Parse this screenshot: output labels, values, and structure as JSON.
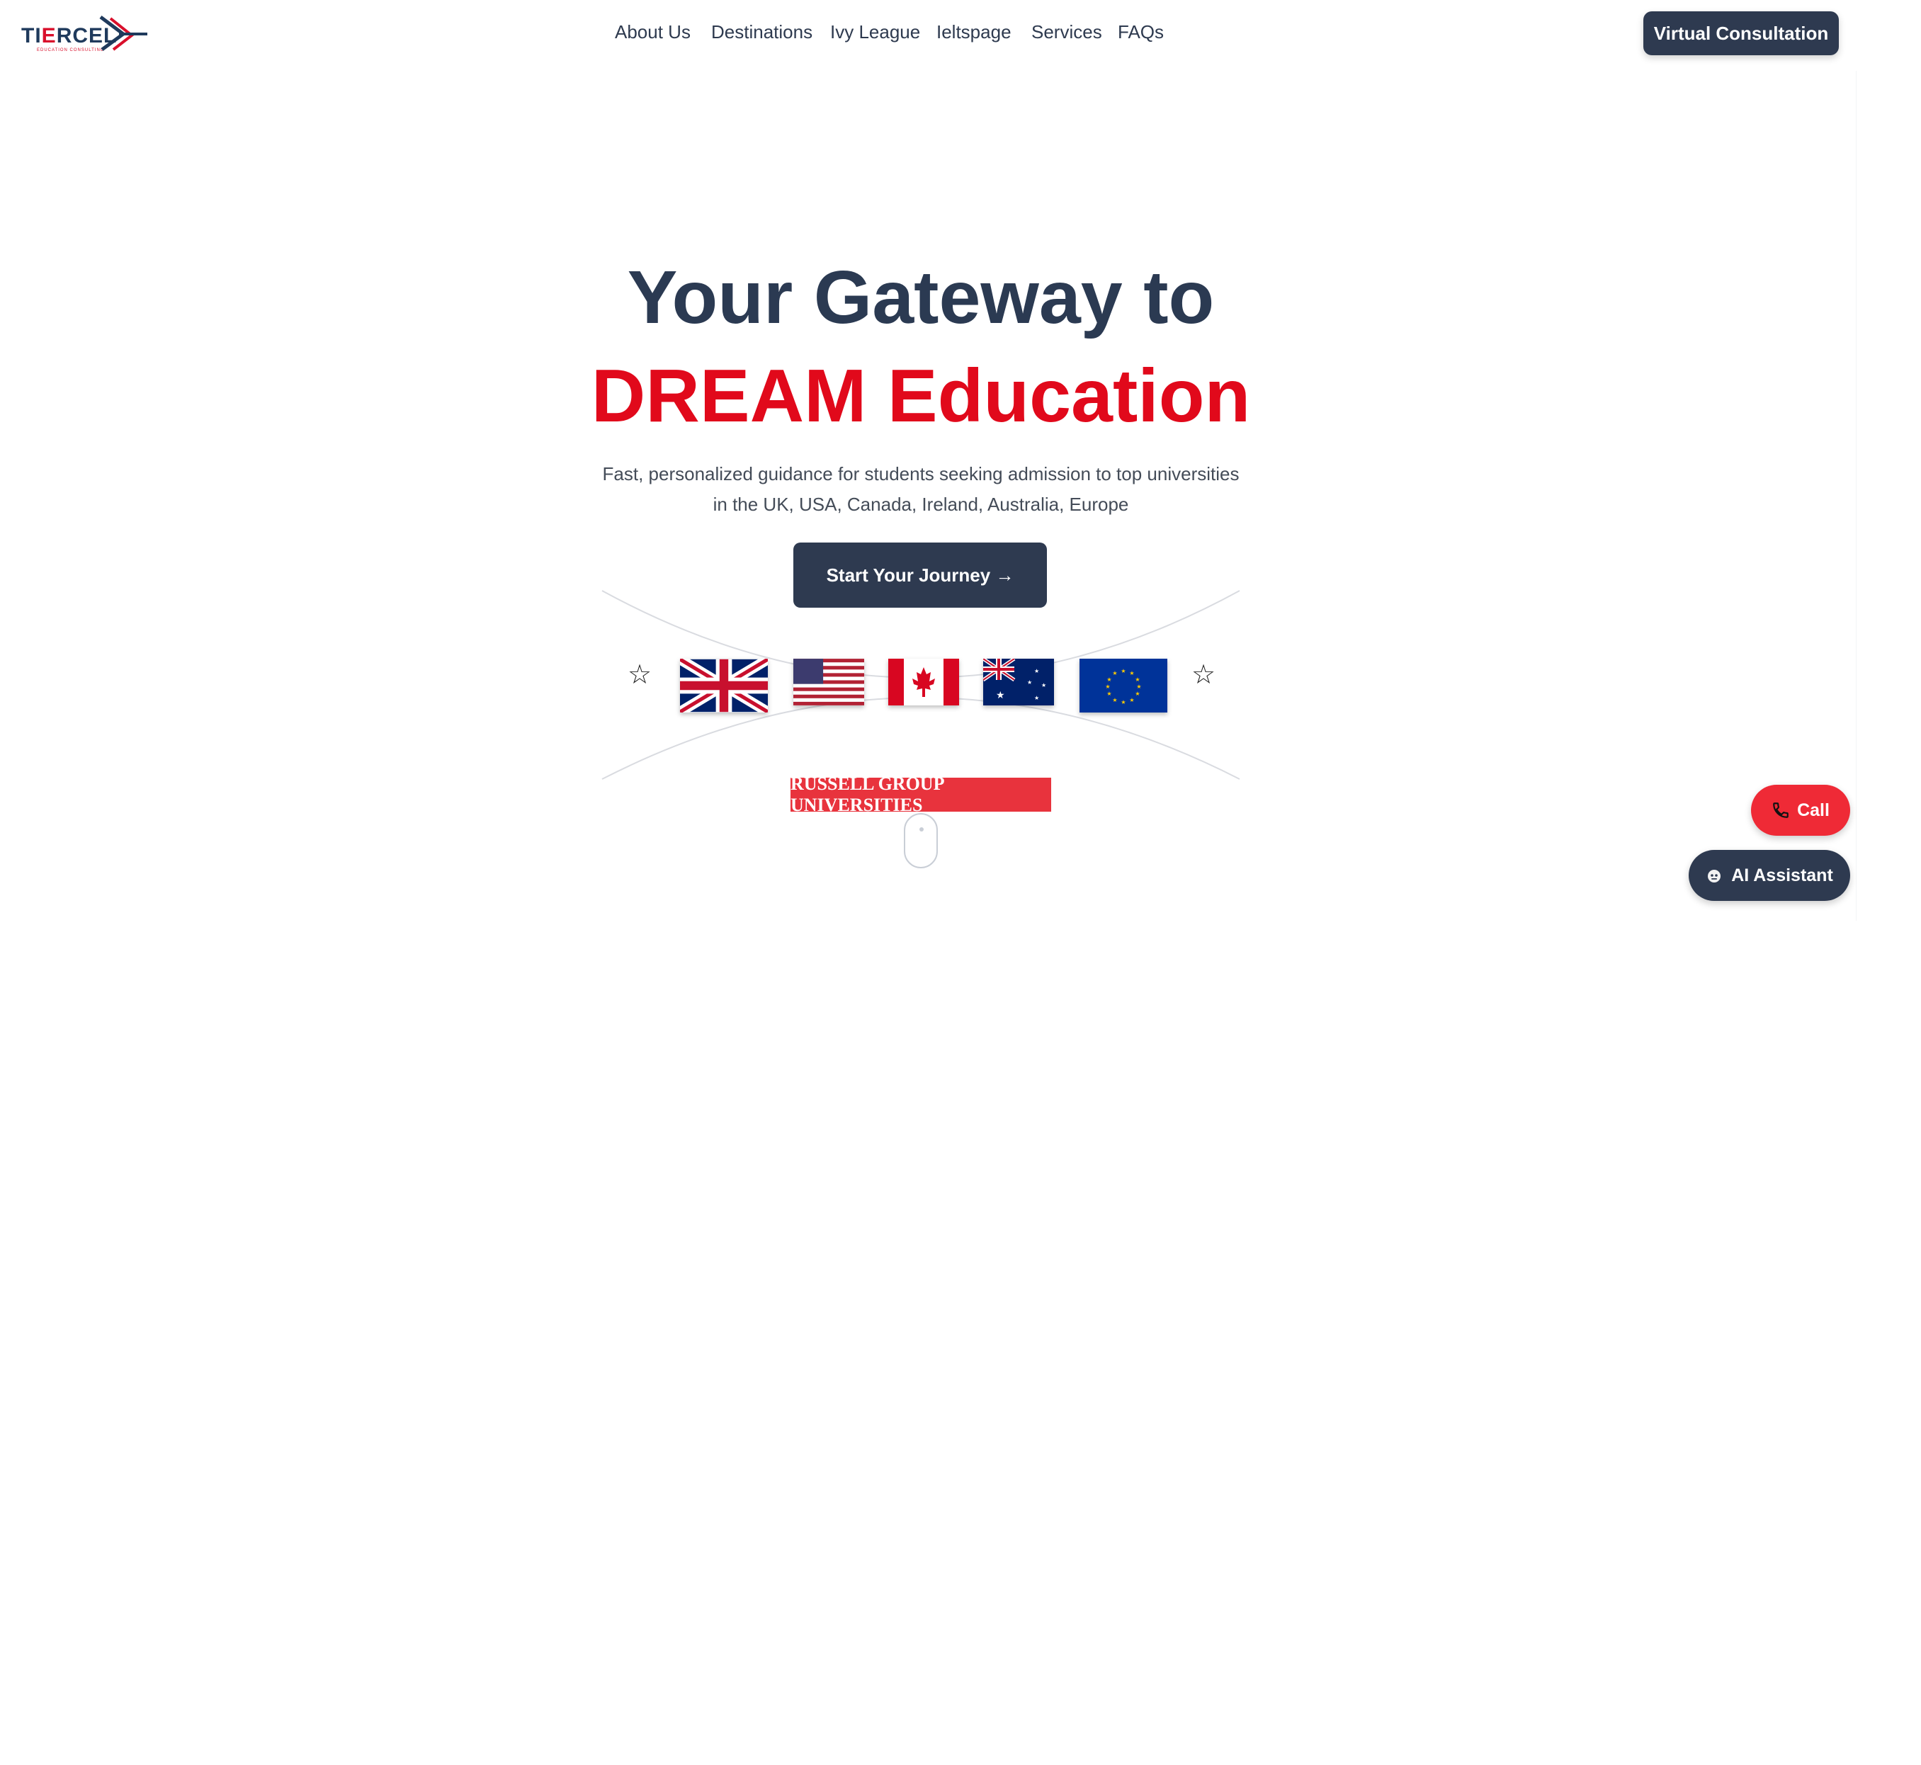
{
  "brand": {
    "logo_text_a": "TI",
    "logo_text_b": "E",
    "logo_text_c": "RCEL",
    "logo_subtext": "EDUCATION CONSULTING"
  },
  "nav": {
    "items": [
      "About Us",
      "Destinations",
      "Ivy League",
      "Ieltspage",
      "Services",
      "FAQs"
    ]
  },
  "header": {
    "consult_label": "Virtual Consultation"
  },
  "hero": {
    "line1": "Your Gateway to",
    "line2": "DREAM Education",
    "subtitle": "Fast, personalized guidance for students seeking admission to top universities in the UK, USA, Canada, Ireland, Australia, Europe",
    "cta_label": "Start Your Journey →"
  },
  "flags": [
    "uk-flag",
    "usa-flag",
    "canada-flag",
    "australia-flag",
    "eu-flag"
  ],
  "banner": {
    "label": "RUSSELL GROUP UNIVERSITIES"
  },
  "floating": {
    "call_label": "Call",
    "ai_label": "AI Assistant"
  },
  "colors": {
    "navy": "#2e3a50",
    "red": "#e1091b",
    "call_red": "#ef2a36"
  }
}
